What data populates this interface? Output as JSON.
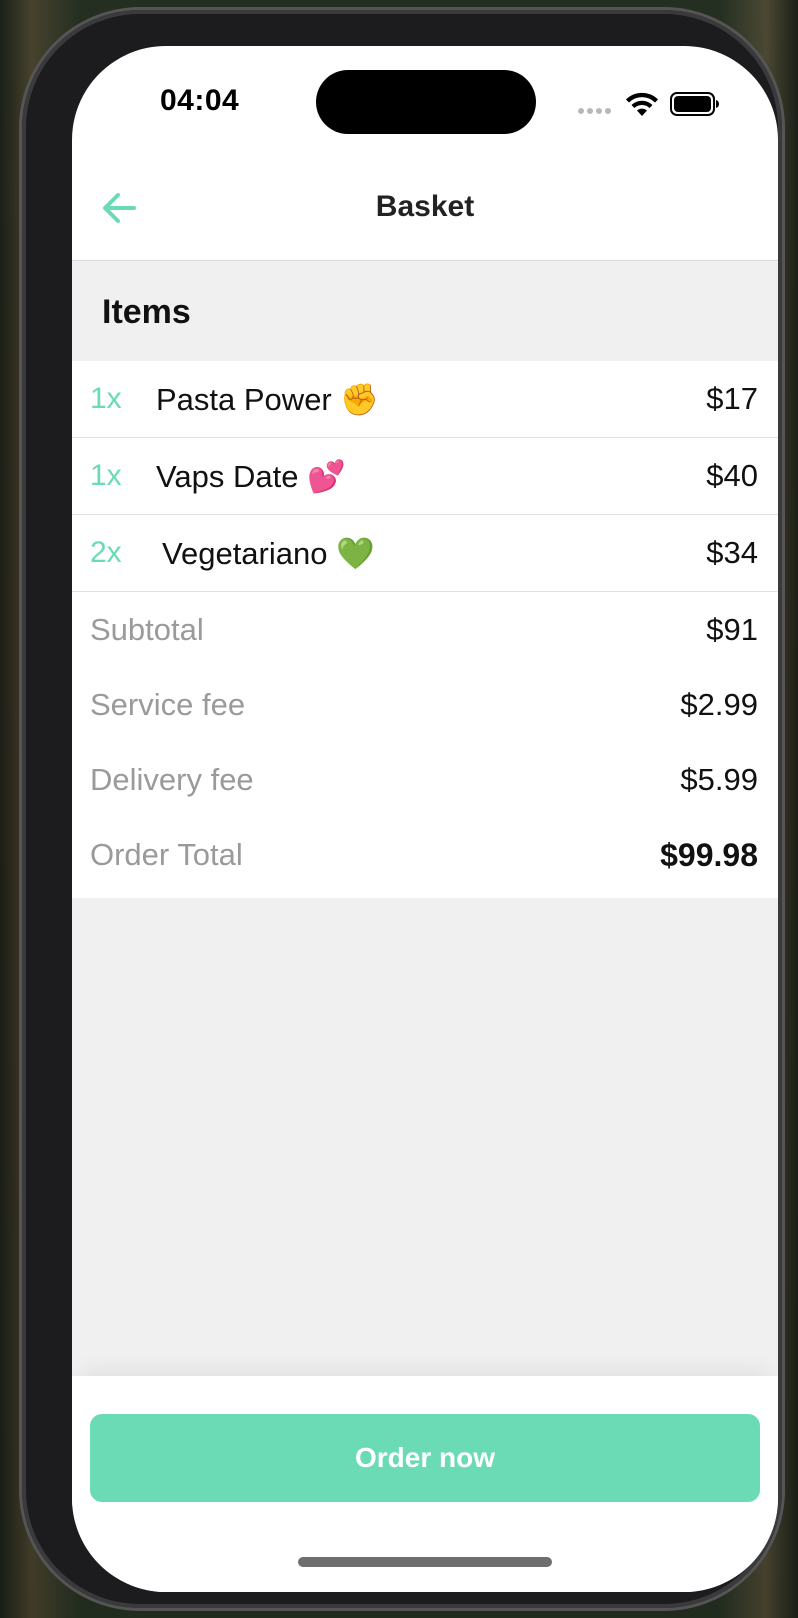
{
  "status_bar": {
    "time": "04:04"
  },
  "nav": {
    "title": "Basket",
    "back_icon": "arrow-left-icon"
  },
  "items_section": {
    "title": "Items"
  },
  "items": [
    {
      "qty": "1x",
      "name": "Pasta Power ✊",
      "price": "$17"
    },
    {
      "qty": "1x",
      "name": "Vaps Date 💕",
      "price": "$40"
    },
    {
      "qty": "2x",
      "name": "Vegetariano 💚",
      "price": "$34"
    }
  ],
  "summary": {
    "subtotal_label": "Subtotal",
    "subtotal_value": "$91",
    "service_fee_label": "Service fee",
    "service_fee_value": "$2.99",
    "delivery_fee_label": "Delivery fee",
    "delivery_fee_value": "$5.99",
    "total_label": "Order Total",
    "total_value": "$99.98"
  },
  "footer": {
    "order_button_label": "Order now"
  },
  "colors": {
    "accent": "#6adbb4",
    "muted_text": "#9a9a9a",
    "background": "#f0f0f0"
  }
}
